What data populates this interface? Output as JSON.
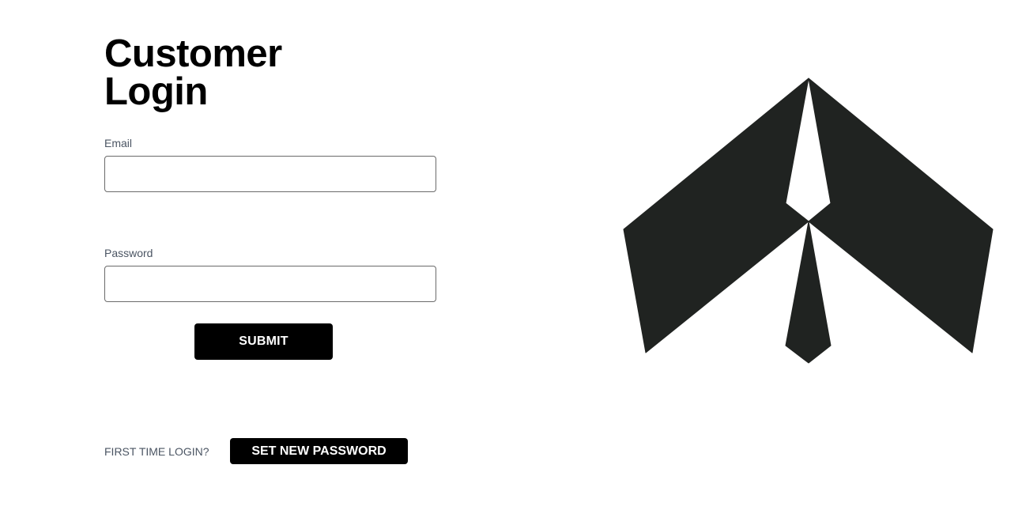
{
  "header": {
    "title_line1": "Customer",
    "title_line2": "Login"
  },
  "form": {
    "email_label": "Email",
    "email_value": "",
    "password_label": "Password",
    "password_value": "",
    "submit_label": "SUBMIT"
  },
  "footer": {
    "first_time_text": "FIRST TIME LOGIN?",
    "set_password_label": "SET NEW PASSWORD"
  },
  "logo": {
    "icon": "brand-logo-icon",
    "color": "#202321"
  }
}
